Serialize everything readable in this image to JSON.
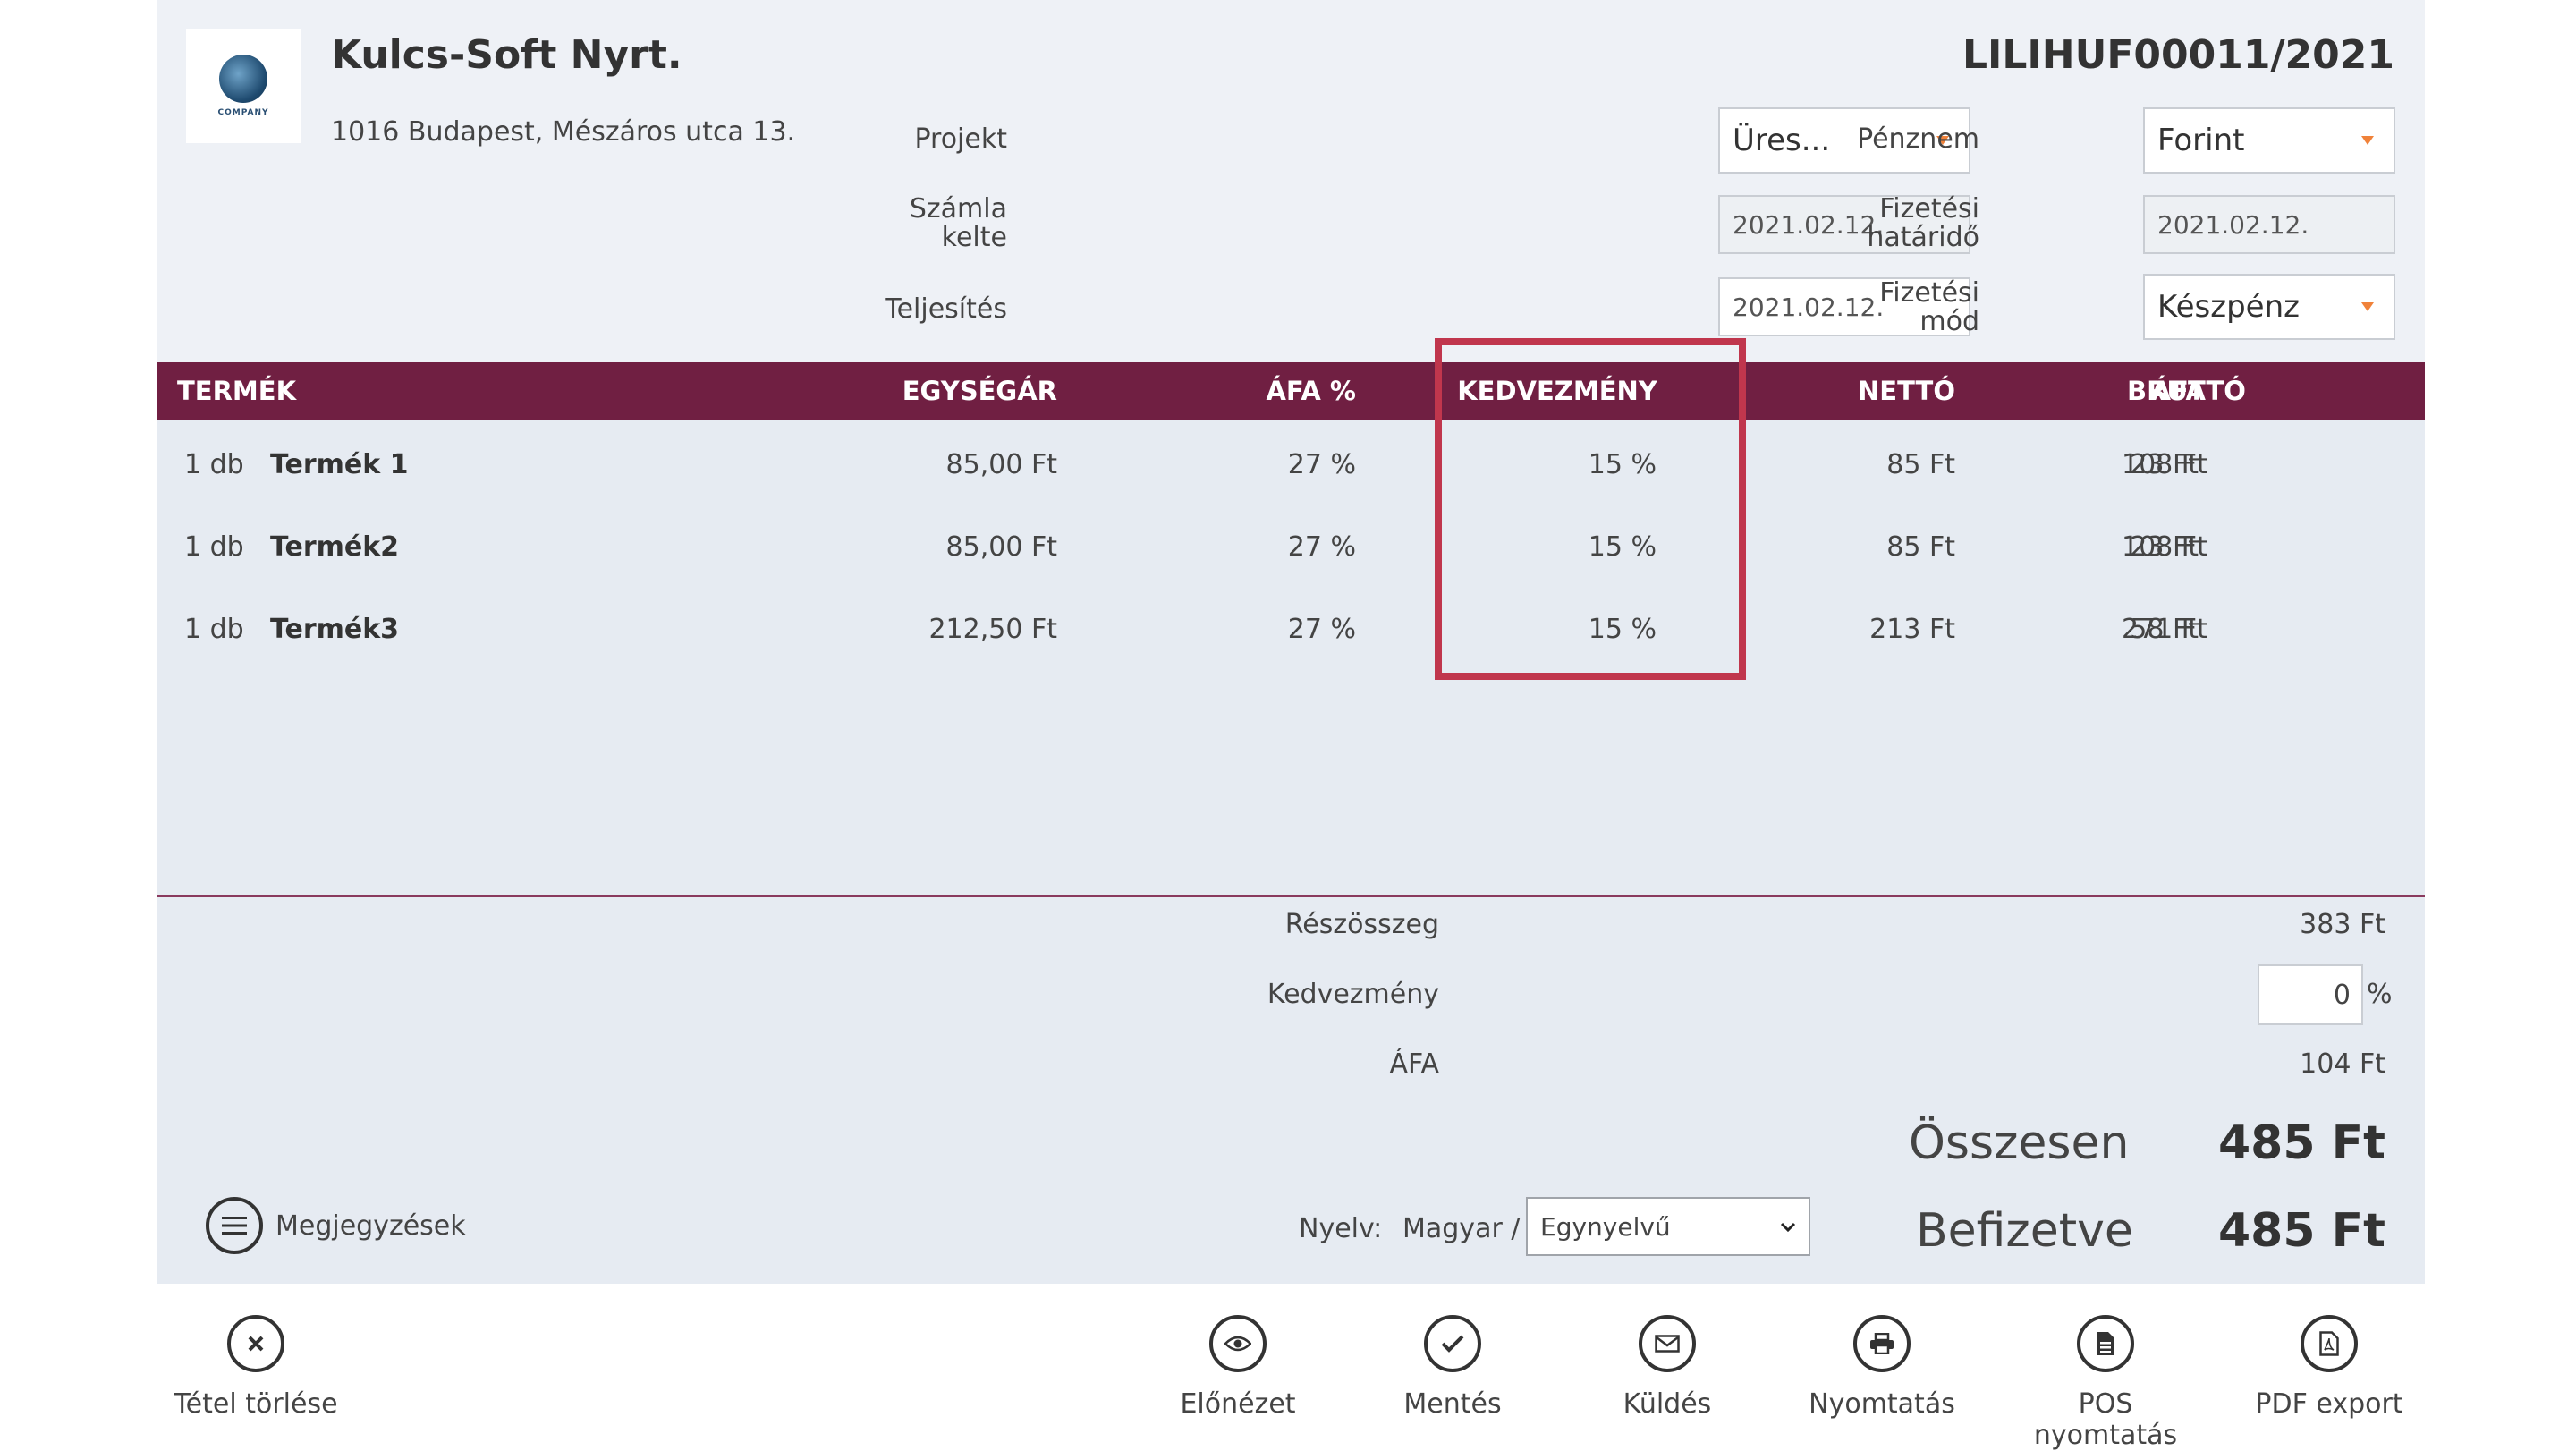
{
  "company": {
    "name": "Kulcs-Soft Nyrt.",
    "address": "1016 Budapest, Mészáros utca 13.",
    "logo_text": "COMPANY"
  },
  "invoice_number": "LILIHUF00011/2021",
  "fields": {
    "projekt": {
      "label": "Projekt",
      "value": "Üres..."
    },
    "penznem": {
      "label": "Pénznem",
      "value": "Forint"
    },
    "szamla_kelte": {
      "label_line1": "Számla",
      "label_line2": "kelte",
      "value": "2021.02.12."
    },
    "fizetesi_hatarido": {
      "label_line1": "Fizetési",
      "label_line2": "határidő",
      "value": "2021.02.12."
    },
    "teljesites": {
      "label": "Teljesítés",
      "value": "2021.02.12."
    },
    "fizetesi_mod": {
      "label_line1": "Fizetési",
      "label_line2": "mód",
      "value": "Készpénz"
    }
  },
  "table": {
    "headers": {
      "termek": "TERMÉK",
      "egysegar": "EGYSÉGÁR",
      "afa_pct": "ÁFA %",
      "kedvezmeny": "KEDVEZMÉNY",
      "netto": "NETTÓ",
      "afa": "ÁFA",
      "brutto": "BRUTTÓ"
    },
    "rows": [
      {
        "qty": "1 db",
        "name": "Termék 1",
        "egysegar": "85,00 Ft",
        "afa_pct": "27 %",
        "kedvezmeny": "15 %",
        "netto": "85 Ft",
        "afa": "23 Ft",
        "brutto": "108 Ft"
      },
      {
        "qty": "1 db",
        "name": "Termék2",
        "egysegar": "85,00 Ft",
        "afa_pct": "27 %",
        "kedvezmeny": "15 %",
        "netto": "85 Ft",
        "afa": "23 Ft",
        "brutto": "108 Ft"
      },
      {
        "qty": "1 db",
        "name": "Termék3",
        "egysegar": "212,50 Ft",
        "afa_pct": "27 %",
        "kedvezmeny": "15 %",
        "netto": "213 Ft",
        "afa": "58 Ft",
        "brutto": "271 Ft"
      }
    ]
  },
  "totals": {
    "reszosszeg_label": "Részösszeg",
    "reszosszeg_value": "383 Ft",
    "kedvezmeny_label": "Kedvezmény",
    "kedvezmeny_value": "0",
    "kedvezmeny_unit": "%",
    "afa_label": "ÁFA",
    "afa_value": "104 Ft",
    "osszesen_label": "Összesen",
    "osszesen_value": "485 Ft",
    "befizetve_label": "Befizetve",
    "befizetve_value": "485 Ft"
  },
  "notes_label": "Megjegyzések",
  "language": {
    "label": "Nyelv:",
    "primary": "Magyar /",
    "select_value": "Egynyelvű"
  },
  "toolbar": {
    "delete_item": "Tétel törlése",
    "preview": "Előnézet",
    "save": "Mentés",
    "send": "Küldés",
    "print": "Nyomtatás",
    "pos_print": "POS nyomtatás",
    "pdf_export": "PDF export"
  },
  "colors": {
    "header_bg": "#701f42",
    "highlight": "#c0364d",
    "dropdown_caret": "#f0823a"
  }
}
